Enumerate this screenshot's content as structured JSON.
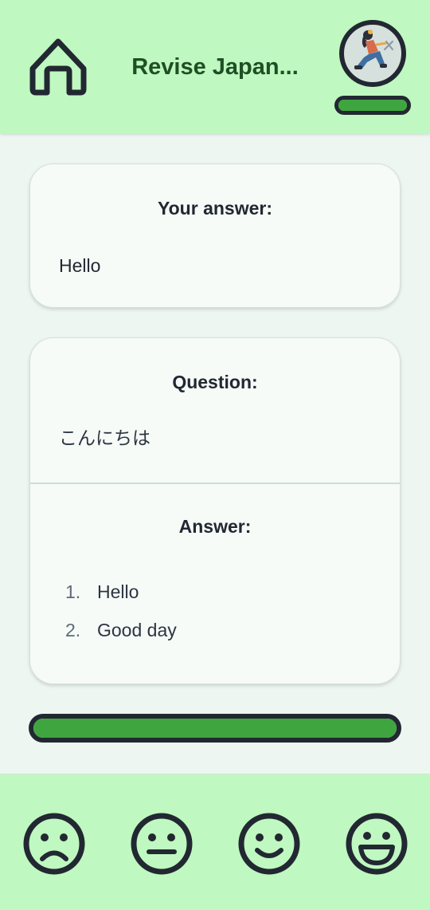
{
  "header": {
    "title": "Revise Japan...",
    "home_icon": "home-icon",
    "avatar_icon": "user-avatar",
    "avatar_progress": 1.0
  },
  "your_answer": {
    "heading": "Your answer:",
    "text": "Hello"
  },
  "question": {
    "heading": "Question:",
    "text": "こんにちは"
  },
  "answer": {
    "heading": "Answer:",
    "items": [
      {
        "num": "1.",
        "text": "Hello"
      },
      {
        "num": "2.",
        "text": "Good day"
      }
    ]
  },
  "progress": {
    "value": 1.0
  },
  "ratings": [
    {
      "icon": "sad-face-icon"
    },
    {
      "icon": "neutral-face-icon"
    },
    {
      "icon": "smile-face-icon"
    },
    {
      "icon": "grin-face-icon"
    }
  ],
  "colors": {
    "header_bg": "#bff8c0",
    "accent_green": "#3fa63f",
    "outline": "#222831",
    "title": "#1f4f24"
  }
}
